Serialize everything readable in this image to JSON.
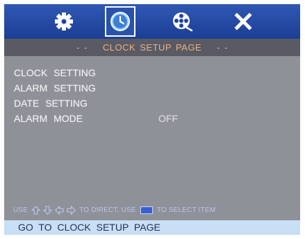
{
  "tabs": [
    {
      "icon": "gear-icon",
      "active": false
    },
    {
      "icon": "clock-icon",
      "active": true
    },
    {
      "icon": "film-reel-icon",
      "active": false
    },
    {
      "icon": "close-icon",
      "active": false
    }
  ],
  "title": {
    "dash_left": "- -",
    "text": "CLOCK SETUP PAGE",
    "dash_right": "- -"
  },
  "menu": [
    {
      "label": "CLOCK  SETTING",
      "value": ""
    },
    {
      "label": "ALARM  SETTING",
      "value": ""
    },
    {
      "label": "DATE    SETTING",
      "value": ""
    },
    {
      "label": "ALARM  MODE",
      "value": "OFF"
    }
  ],
  "hint": {
    "use1": "USE",
    "to_direct": "TO DIRECT, USE",
    "to_select": "TO SELECT  ITEM"
  },
  "status": "GO  TO  CLOCK  SETUP  PAGE",
  "colors": {
    "tabbar": "#1c3e95",
    "titlebar": "#595a63",
    "title_text": "#e8b18a",
    "panel": "#8f9198",
    "hint_text": "#b8c4ee",
    "status_bg": "#c9dff6"
  }
}
